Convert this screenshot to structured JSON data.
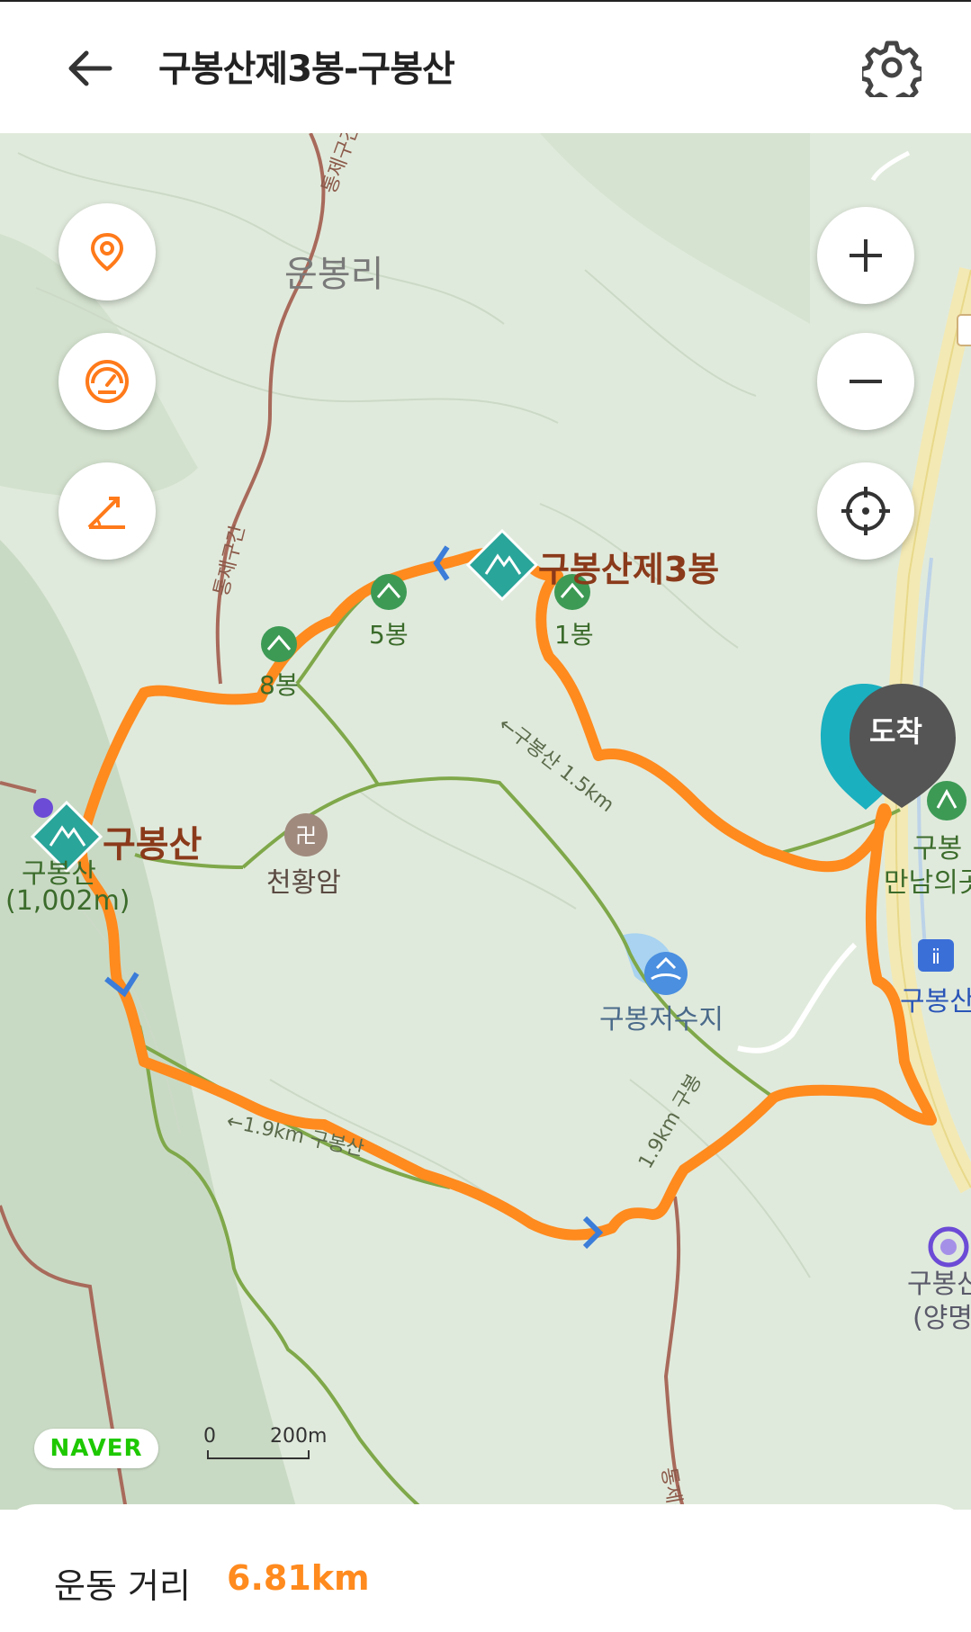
{
  "header": {
    "title": "구봉산제3봉-구봉산"
  },
  "map": {
    "labels": {
      "village": "운봉리",
      "restricted_1": "통제구간",
      "restricted_2": "통제구간",
      "restricted_3": "통제구",
      "peak3": "구봉산제3봉",
      "peak5": "5봉",
      "peak1": "1봉",
      "peak8": "8봉",
      "main_peak": "구봉산",
      "main_peak_sub1": "구봉산",
      "main_peak_sub2": "(1,002m)",
      "temple": "천황암",
      "reservoir": "구봉저수지",
      "trail_a": "←구봉산 1.5km",
      "trail_b": "←1.9km 구봉산",
      "trail_c": "1.9km 구봉",
      "right_1": "구봉",
      "right_2": "만남의곳",
      "right_3": "구봉산",
      "right_4": "구봉산",
      "right_5": "(양명",
      "arrival": "도착"
    },
    "naver_logo": "NAVER",
    "scale": {
      "zero": "0",
      "distance": "200m"
    },
    "colors": {
      "route": "#ff8a1e",
      "trail": "#7fa84a",
      "road": "#a86a5b",
      "peak_marker": "#2aa59a"
    }
  },
  "controls": {
    "left": [
      "location-pin-icon",
      "speedometer-icon",
      "slope-angle-icon"
    ],
    "right": [
      "zoom-in-icon",
      "zoom-out-icon",
      "crosshair-icon"
    ]
  },
  "summary": {
    "distance_label": "운동 거리",
    "distance_value": "6.81km"
  }
}
